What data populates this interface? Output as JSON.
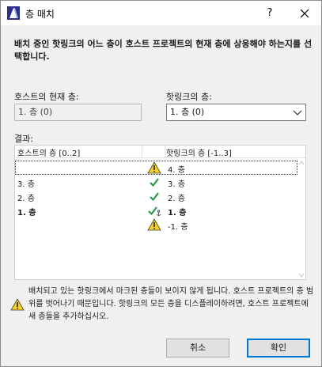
{
  "window": {
    "title": "층 매치",
    "help_label": "?",
    "app_icon": "archicad-app-icon"
  },
  "instruction": "배치 중인 핫링크의 어느 층이 호스트 프로젝트의 현재 층에 상응해야 하는지를 선택합니다.",
  "host_current": {
    "label": "호스트의 현재 층:",
    "value": "1. 층 (0)"
  },
  "hotlink_story": {
    "label": "핫링크의 층:",
    "value": "1. 층 (0)"
  },
  "results": {
    "label": "결과:",
    "columns": [
      "호스트의 층 [0..2]",
      "핫링크의 층 [-1..3]"
    ],
    "rows": [
      {
        "host": "",
        "status": "warning",
        "hotlink": "4. 층",
        "selected": true,
        "bold": false
      },
      {
        "host": "3. 층",
        "status": "check",
        "hotlink": "3. 층",
        "selected": false,
        "bold": false
      },
      {
        "host": "2. 층",
        "status": "check",
        "hotlink": "2. 층",
        "selected": false,
        "bold": false
      },
      {
        "host": "1. 층",
        "status": "check-anchor",
        "hotlink": "1. 층",
        "selected": false,
        "bold": true
      },
      {
        "host": "",
        "status": "warning",
        "hotlink": "-1. 층",
        "selected": false,
        "bold": false
      }
    ]
  },
  "warning_text": "배치되고 있는 핫링크에서 마크된 층들이 보이지 않게 됩니다. 호스트 프로젝트의 층 범위를 벗어나기 때문입니다. 핫링크의 모든 층을 디스플레이하려면, 호스트 프로젝트에 새 층들을 추가하십시오.",
  "buttons": {
    "cancel": "취소",
    "ok": "확인"
  },
  "colors": {
    "check": "#1a9a3a",
    "warning_fill": "#f7d31b",
    "focus_border": "#0078d7"
  }
}
